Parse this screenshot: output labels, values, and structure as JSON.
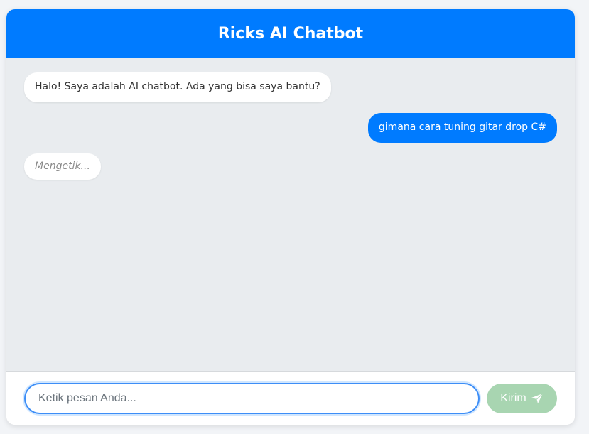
{
  "header": {
    "title": "Ricks AI Chatbot"
  },
  "messages": [
    {
      "sender": "bot",
      "text": "Halo! Saya adalah AI chatbot. Ada yang bisa saya bantu?"
    },
    {
      "sender": "user",
      "text": "gimana cara tuning gitar drop C#"
    }
  ],
  "typing": {
    "text": "Mengetik..."
  },
  "composer": {
    "placeholder": "Ketik pesan Anda...",
    "value": "",
    "send_label": "Kirim",
    "send_icon": "paper-plane-icon"
  },
  "colors": {
    "accent": "#007bff",
    "chat_background": "#e9ecef",
    "send_button_disabled": "#a8d5b1"
  }
}
